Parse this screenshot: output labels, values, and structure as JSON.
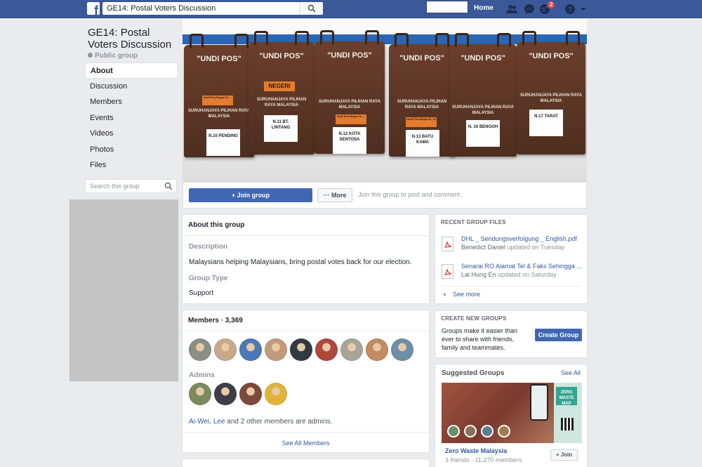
{
  "topbar": {
    "logo_letter": "f",
    "search_value": "GE14: Postal Voters Discussion",
    "home_label": "Home",
    "notification_count": "2"
  },
  "group": {
    "name": "GE14: Postal Voters Discussion",
    "privacy": "Public group"
  },
  "left_nav": {
    "items": [
      {
        "label": "About"
      },
      {
        "label": "Discussion"
      },
      {
        "label": "Members"
      },
      {
        "label": "Events"
      },
      {
        "label": "Videos"
      },
      {
        "label": "Photos"
      },
      {
        "label": "Files"
      }
    ],
    "search_placeholder": "Search this group"
  },
  "cover": {
    "bags": [
      {
        "title": "\"UNDI POS\"",
        "tag": "Undi Pos Negeri N. ...",
        "org": "SURUHANJAYA PILIHAN RAYA MALAYSIA",
        "label": "N.10 PENDING"
      },
      {
        "title": "\"UNDI POS\"",
        "tag": "NEGERI",
        "org": "SURUHANJAYA PILIHAN RAYA MALAYSIA",
        "label": "N.11 BT. LINTANG"
      },
      {
        "title": "\"UNDI POS\"",
        "tag": "Undi Pos Negeri N. ...",
        "org": "SURUHANJAYA PILIHAN RAYA MALAYSIA",
        "label": "N.12 KOTA SENTOSA"
      },
      {
        "title": "\"UNDI POS\"",
        "tag": "Undi Pos Negeri N. 13",
        "org": "SURUHANJAYA PILIHAN RAYA MALAYSIA",
        "label": "N.13 BATU KAWA"
      },
      {
        "title": "\"UNDI POS\"",
        "tag": "",
        "org": "SURUHANJAYA PILIHAN RAYA MALAYSIA",
        "label": "N. 16 BENGOH"
      },
      {
        "title": "\"UNDI POS\"",
        "tag": "",
        "org": "SURUHANJAYA PILIHAN RAYA MALAYSIA",
        "label": "N.17 TARAT"
      }
    ]
  },
  "join_bar": {
    "join_label": "+ Join group",
    "more_label": "··· More",
    "hint": "Join this group to post and comment."
  },
  "about": {
    "heading": "About this group",
    "description_label": "Description",
    "description": "Malaysians helping Malaysians, bring postal votes back for our election.",
    "type_label": "Group Type",
    "type": "Support"
  },
  "members": {
    "heading": "Members · 3,369",
    "avatar_colors": [
      "#8a8f86",
      "#c9a98c",
      "#4a79b8",
      "#c29b7a",
      "#2f3a44",
      "#b0473c",
      "#a9a49a",
      "#c58a5f",
      "#6d8fa8"
    ],
    "admins_label": "Admins",
    "admin_avatar_colors": [
      "#7c8a5e",
      "#3d3f46",
      "#7a4a3c",
      "#e0b43a"
    ],
    "admins_link": "Ai-Wei, Lee",
    "admins_rest": " and 2 other members are admins.",
    "see_all": "See All Members"
  },
  "files": {
    "heading": "Recent Group Files",
    "items": [
      {
        "name": "DHL _ Sendungsverfolgung _ English.pdf",
        "author": "Benedict Daniel",
        "meta": " updated on Tuesday"
      },
      {
        "name": "Senarai RO Alamat Tel & Faks Sehingga ...",
        "author": "Lai Hung En",
        "meta": " updated on Saturday"
      }
    ],
    "see_more": "See more"
  },
  "create_groups": {
    "heading": "Create New Groups",
    "text": "Groups make it easier than ever to share with friends, family and teammates.",
    "button": "Create Group"
  },
  "suggested": {
    "heading": "Suggested Groups",
    "see_all": "See All",
    "poster_text": "ZERO WASTE MAP",
    "name": "Zero Waste Malaysia",
    "meta": "3 friends · 11,270 members",
    "join": "+ Join"
  }
}
